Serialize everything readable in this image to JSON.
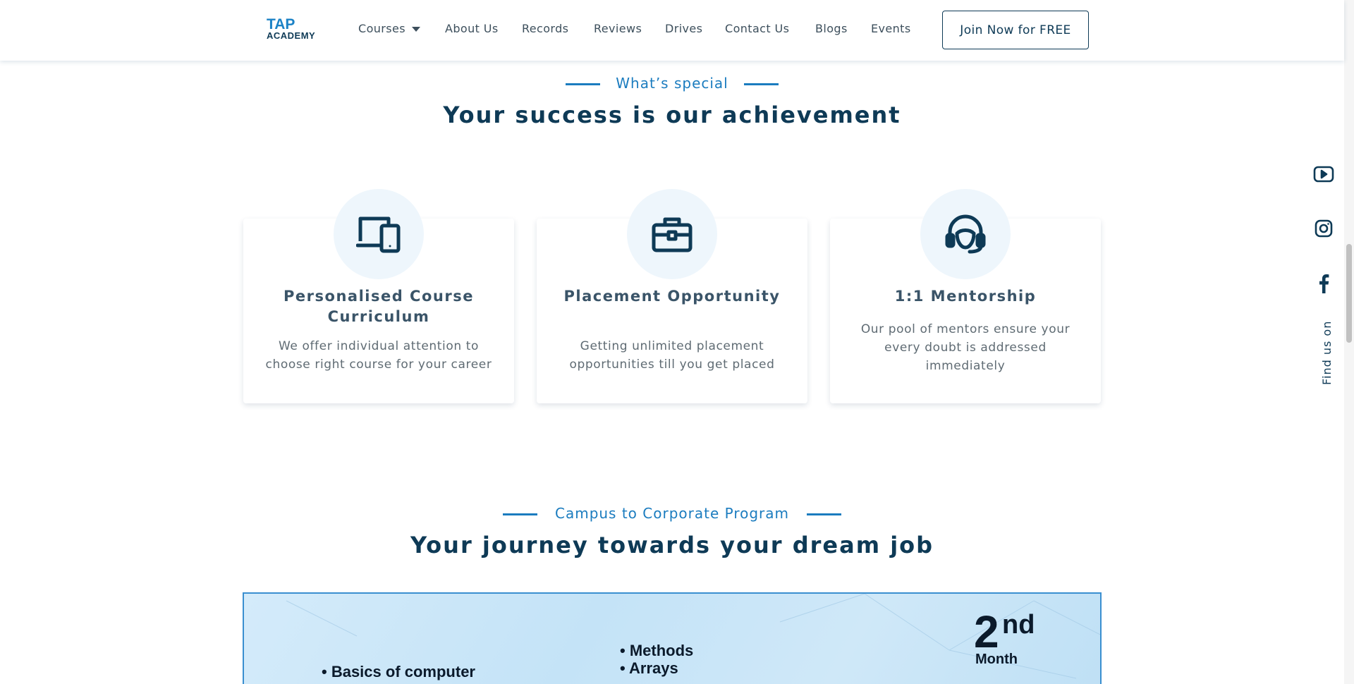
{
  "header": {
    "logo": {
      "top": "TAP",
      "bottom": "ACADEMY"
    },
    "nav": [
      {
        "label": "Courses",
        "has_dropdown": true
      },
      {
        "label": "About Us"
      },
      {
        "label": "Records"
      },
      {
        "label": "Reviews"
      },
      {
        "label": "Drives"
      },
      {
        "label": "Contact Us"
      },
      {
        "label": "Blogs"
      },
      {
        "label": "Events"
      }
    ],
    "cta_label": "Join Now for FREE"
  },
  "special": {
    "eyebrow": "What’s special",
    "title": "Your success is our achievement",
    "cards": [
      {
        "icon": "devices-icon",
        "title": "Personalised Course Curriculum",
        "text": "We offer individual attention to choose right course for your career"
      },
      {
        "icon": "briefcase-icon",
        "title": "Placement Opportunity",
        "text": "Getting unlimited placement opportunities till you get placed"
      },
      {
        "icon": "headset-icon",
        "title": "1:1 Mentorship",
        "text": "Our pool of mentors ensure your every doubt is addressed immediately"
      }
    ]
  },
  "program": {
    "eyebrow": "Campus to Corporate Program",
    "title": "Your journey towards your dream job",
    "banner": {
      "item_1": "Basics of computer",
      "item_2": "Methods",
      "item_3": "Arrays",
      "month_number": "2",
      "month_suffix": "nd",
      "month_word": "Month"
    }
  },
  "social": {
    "icons": [
      "youtube-icon",
      "instagram-icon",
      "facebook-icon"
    ],
    "label": "Find us on"
  },
  "colors": {
    "brand_blue": "#1b7cbf",
    "navy": "#0e3a56",
    "icon_bg": "#eef6fc"
  }
}
